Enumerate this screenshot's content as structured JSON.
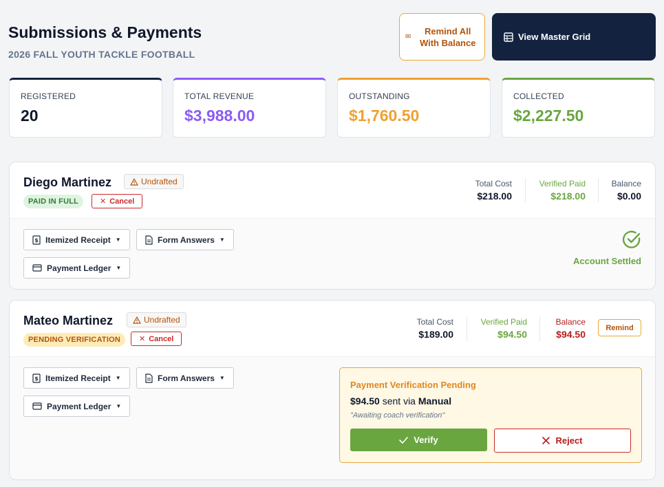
{
  "header": {
    "title": "Submissions & Payments",
    "subtitle": "2026 FALL YOUTH TACKLE FOOTBALL",
    "remind_all_label": "Remind All With Balance",
    "master_grid_label": "View Master Grid"
  },
  "stats": [
    {
      "label": "REGISTERED",
      "value": "20",
      "color": "#0f172a",
      "accent": "#13233f"
    },
    {
      "label": "TOTAL REVENUE",
      "value": "$3,988.00",
      "color": "#8b5cf6",
      "accent": "#8b5cf6"
    },
    {
      "label": "OUTSTANDING",
      "value": "$1,760.50",
      "color": "#f0a030",
      "accent": "#f0a030"
    },
    {
      "label": "COLLECTED",
      "value": "$2,227.50",
      "color": "#6aa63f",
      "accent": "#6aa63f"
    }
  ],
  "submissions": [
    {
      "name": "Diego Martinez",
      "draft_status": "Undrafted",
      "status": "PAID IN FULL",
      "cancel_label": "Cancel",
      "total_cost_label": "Total Cost",
      "total_cost": "$218.00",
      "verified_paid_label": "Verified Paid",
      "verified_paid": "$218.00",
      "balance_label": "Balance",
      "balance": "$0.00",
      "actions": {
        "receipt": "Itemized Receipt",
        "form": "Form Answers",
        "ledger": "Payment Ledger"
      },
      "settled_text": "Account Settled"
    },
    {
      "name": "Mateo Martinez",
      "draft_status": "Undrafted",
      "status": "PENDING VERIFICATION",
      "cancel_label": "Cancel",
      "total_cost_label": "Total Cost",
      "total_cost": "$189.00",
      "verified_paid_label": "Verified Paid",
      "verified_paid": "$94.50",
      "balance_label": "Balance",
      "balance": "$94.50",
      "remind_label": "Remind",
      "actions": {
        "receipt": "Itemized Receipt",
        "form": "Form Answers",
        "ledger": "Payment Ledger"
      },
      "verification": {
        "title": "Payment Verification Pending",
        "amount": "$94.50",
        "sent_via_text": "sent via",
        "method": "Manual",
        "note": "\"Awaiting coach verification\"",
        "verify_label": "Verify",
        "reject_label": "Reject"
      }
    }
  ],
  "colors": {
    "navy": "#13233f",
    "green": "#6aa63f",
    "orange": "#f0a030",
    "red": "#c92a2a",
    "purple": "#8b5cf6"
  }
}
